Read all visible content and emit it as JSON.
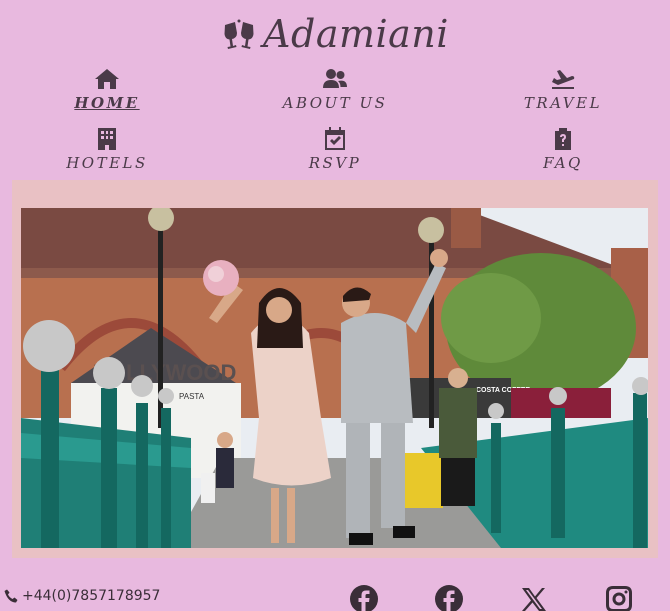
{
  "brand": {
    "name": "Adamiani",
    "icon": "champagne-glasses-icon"
  },
  "nav": {
    "items": [
      {
        "label": "HOME",
        "icon": "home-icon",
        "active": true
      },
      {
        "label": "ABOUT US",
        "icon": "users-icon",
        "active": false
      },
      {
        "label": "TRAVEL",
        "icon": "plane-icon",
        "active": false
      },
      {
        "label": "HOTELS",
        "icon": "hotel-icon",
        "active": false
      },
      {
        "label": "RSVP",
        "icon": "calendar-check-icon",
        "active": false
      },
      {
        "label": "FAQ",
        "icon": "clipboard-question-icon",
        "active": false
      }
    ]
  },
  "hero": {
    "signage": {
      "store": "HOLLYWOOD",
      "pasta": "PASTA",
      "cafe": "COSTA COFFEE"
    }
  },
  "footer": {
    "phone": "+44(0)7857178957",
    "phone_icon": "phone-icon",
    "social": [
      "facebook-icon",
      "facebook-icon",
      "x-twitter-icon",
      "instagram-icon"
    ]
  },
  "colors": {
    "background": "#e8b9df",
    "frame": "#e9c1c4",
    "text": "#4a3a48"
  }
}
